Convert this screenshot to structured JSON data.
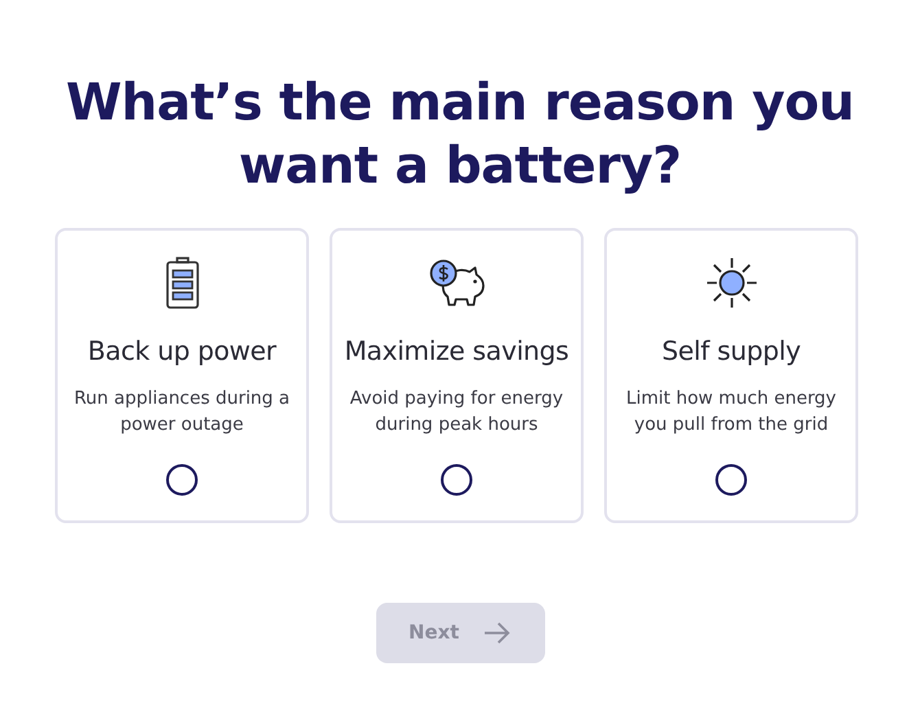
{
  "heading": "What’s the main reason you want a battery?",
  "options": [
    {
      "kind": "battery",
      "title": "Back up power",
      "description": "Run appliances during a power outage",
      "selected": false
    },
    {
      "kind": "savings",
      "title": "Maximize savings",
      "description": "Avoid paying for energy during peak hours",
      "selected": false
    },
    {
      "kind": "sun",
      "title": "Self supply",
      "description": "Limit how much energy you pull from the grid",
      "selected": false
    }
  ],
  "next_button": {
    "label": "Next",
    "disabled": true
  }
}
